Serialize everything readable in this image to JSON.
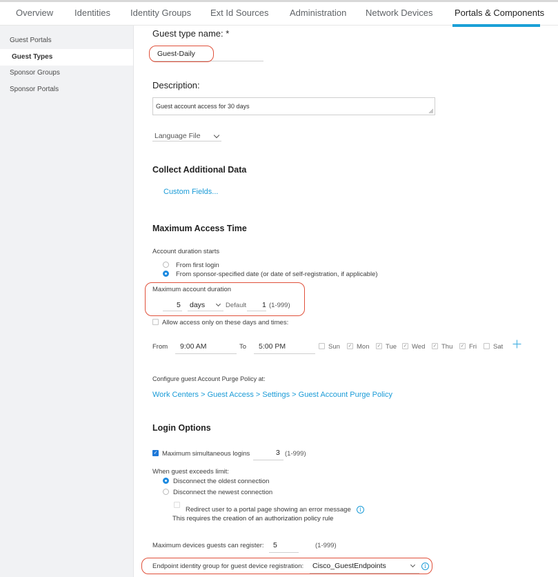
{
  "nav": {
    "tabs": [
      {
        "label": "Overview",
        "active": false
      },
      {
        "label": "Identities",
        "active": false
      },
      {
        "label": "Identity Groups",
        "active": false
      },
      {
        "label": "Ext Id Sources",
        "active": false
      },
      {
        "label": "Administration",
        "active": false
      },
      {
        "label": "Network Devices",
        "active": false
      },
      {
        "label": "Portals & Components",
        "active": true
      }
    ],
    "accent_color": "#1ba0d7"
  },
  "sidebar": {
    "items": [
      {
        "label": "Guest Portals",
        "active": false
      },
      {
        "label": "Guest Types",
        "active": true
      },
      {
        "label": "Sponsor Groups",
        "active": false
      },
      {
        "label": "Sponsor Portals",
        "active": false
      }
    ]
  },
  "form": {
    "guest_type_name_label": "Guest type name: *",
    "guest_type_name_value": "Guest-Daily",
    "description_label": "Description:",
    "description_value": "Guest account access for 30 days",
    "language_file_label": "Language File",
    "collect_section": "Collect Additional Data",
    "custom_fields_link": "Custom Fields...",
    "max_access_section": "Maximum Access Time",
    "duration_starts_label": "Account duration starts",
    "duration_options": [
      {
        "label": "From first login",
        "selected": false
      },
      {
        "label": "From sponsor-specified date (or date of self-registration, if applicable)",
        "selected": true
      }
    ],
    "max_duration_label": "Maximum account duration",
    "max_duration_value": "5",
    "max_duration_unit": "days",
    "default_label": "Default",
    "default_value": "1",
    "default_range": "(1-999)",
    "allow_days_label": "Allow access only on these days and times:",
    "allow_days_checked": false,
    "from_label": "From",
    "from_time": "9:00 AM",
    "to_label": "To",
    "to_time": "5:00 PM",
    "days": [
      {
        "label": "Sun",
        "checked": false
      },
      {
        "label": "Mon",
        "checked": true
      },
      {
        "label": "Tue",
        "checked": true
      },
      {
        "label": "Wed",
        "checked": true
      },
      {
        "label": "Thu",
        "checked": true
      },
      {
        "label": "Fri",
        "checked": true
      },
      {
        "label": "Sat",
        "checked": false
      }
    ],
    "add_icon": "plus-icon",
    "purge_label": "Configure guest Account Purge Policy at:",
    "purge_link": "Work Centers > Guest Access > Settings > Guest Account Purge Policy",
    "login_section": "Login Options",
    "max_logins_label": "Maximum simultaneous logins",
    "max_logins_checked": true,
    "max_logins_value": "3",
    "max_logins_range": "(1-999)",
    "exceeds_label": "When guest exceeds limit:",
    "exceeds_options": [
      {
        "label": "Disconnect the oldest connection",
        "selected": true
      },
      {
        "label": "Disconnect the newest connection",
        "selected": false
      }
    ],
    "redirect_label": "Redirect user to a portal page showing an error message",
    "redirect_checked": false,
    "redirect_note": "This requires the creation of an authorization policy rule",
    "max_devices_label": "Maximum devices guests can register:",
    "max_devices_value": "5",
    "max_devices_range": "(1-999)",
    "endpoint_group_label": "Endpoint identity group for guest device registration:",
    "endpoint_group_value": "Cisco_GuestEndpoints",
    "highlight_color": "#e0503a"
  }
}
